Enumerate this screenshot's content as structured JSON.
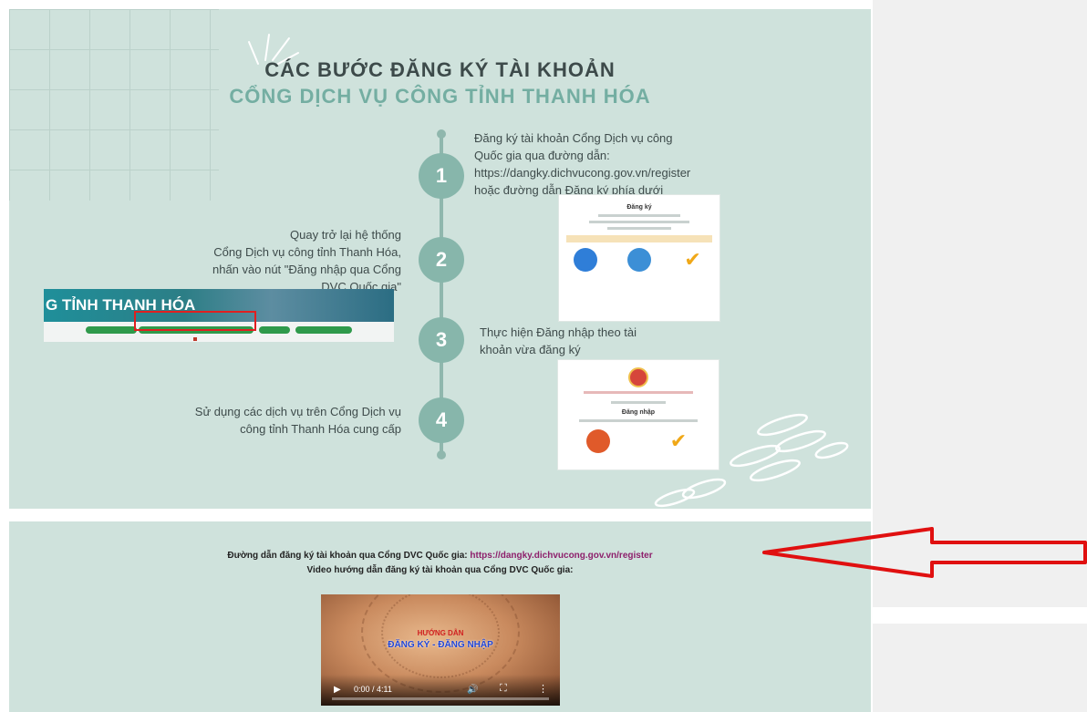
{
  "infographic": {
    "title_line1": "CÁC BƯỚC ĐĂNG KÝ TÀI KHOẢN",
    "title_line2": "CỔNG DỊCH VỤ CÔNG TỈNH THANH HÓA",
    "steps": [
      {
        "number": "1",
        "lines": [
          "Đăng ký tài khoản Cổng Dịch vụ công",
          "Quốc gia qua đường dẫn:",
          "https://dangky.dichvucong.gov.vn/register",
          "hoặc đường dẫn Đăng ký phía dưới"
        ]
      },
      {
        "number": "2",
        "lines": [
          "Quay trở lại hệ thống",
          "Cổng Dịch vụ công tỉnh Thanh Hóa,",
          "nhấn vào nút \"Đăng nhập qua Cổng",
          "DVC Quốc gia\""
        ]
      },
      {
        "number": "3",
        "lines": [
          "Thực hiện Đăng nhập theo tài",
          "khoản vừa đăng ký"
        ]
      },
      {
        "number": "4",
        "lines": [
          "Sử dụng các dịch vụ trên Cổng Dịch vụ",
          "công tỉnh Thanh Hóa cung cấp"
        ]
      }
    ],
    "register_thumb": {
      "title": "Đăng ký"
    },
    "login_thumb": {
      "title": "Đăng nhập"
    },
    "banner": {
      "title": "G TỈNH THANH HÓA"
    }
  },
  "bottom": {
    "register_link_label": "Đường dẫn đăng ký tài khoản qua Cổng DVC Quốc gia:",
    "register_link_url": "https://dangky.dichvucong.gov.vn/register",
    "video_label": "Video hướng dẫn đăng ký tài khoản qua Cổng DVC Quốc gia:"
  },
  "video": {
    "subtitle": "HƯỚNG DẪN",
    "title": "ĐĂNG KÝ - ĐĂNG NHẬP",
    "time": "0:00 / 4:11",
    "progress": 0
  },
  "colors": {
    "panel_bg": "#cfe2dc",
    "accent_teal": "#87b6ab",
    "link_purple": "#8d1f6b",
    "arrow_red": "#e01010"
  }
}
